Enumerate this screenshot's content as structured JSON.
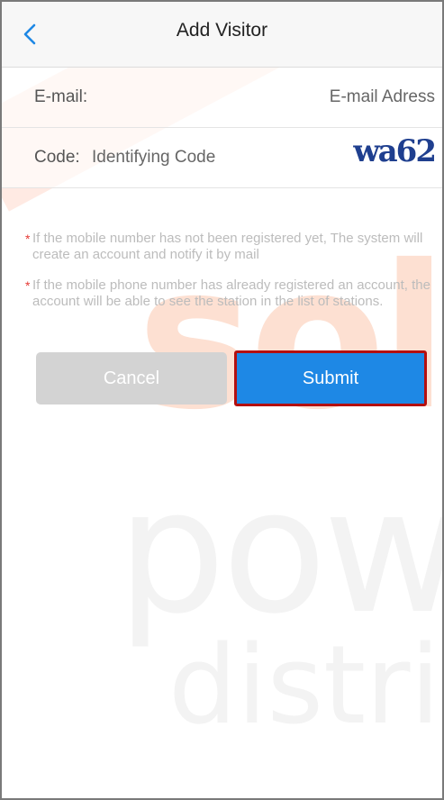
{
  "header": {
    "title": "Add Visitor"
  },
  "form": {
    "email_label": "E-mail:",
    "email_placeholder": "E-mail Adress",
    "code_label": "Code:",
    "code_placeholder": "Identifying Code",
    "captcha_text": "wa62"
  },
  "notes": [
    "If the mobile number has not been registered yet, The system will create an account and notify it by mail",
    "If the mobile phone number has already registered an account, the account will be able to see the station in the list of stations."
  ],
  "buttons": {
    "cancel": "Cancel",
    "submit": "Submit"
  },
  "watermark": {
    "line1": "sol",
    "line2": "pow",
    "line3": "distrib"
  },
  "colors": {
    "primary": "#1e88e5",
    "highlight_border": "#b40f0f",
    "required_star": "#e53935"
  }
}
